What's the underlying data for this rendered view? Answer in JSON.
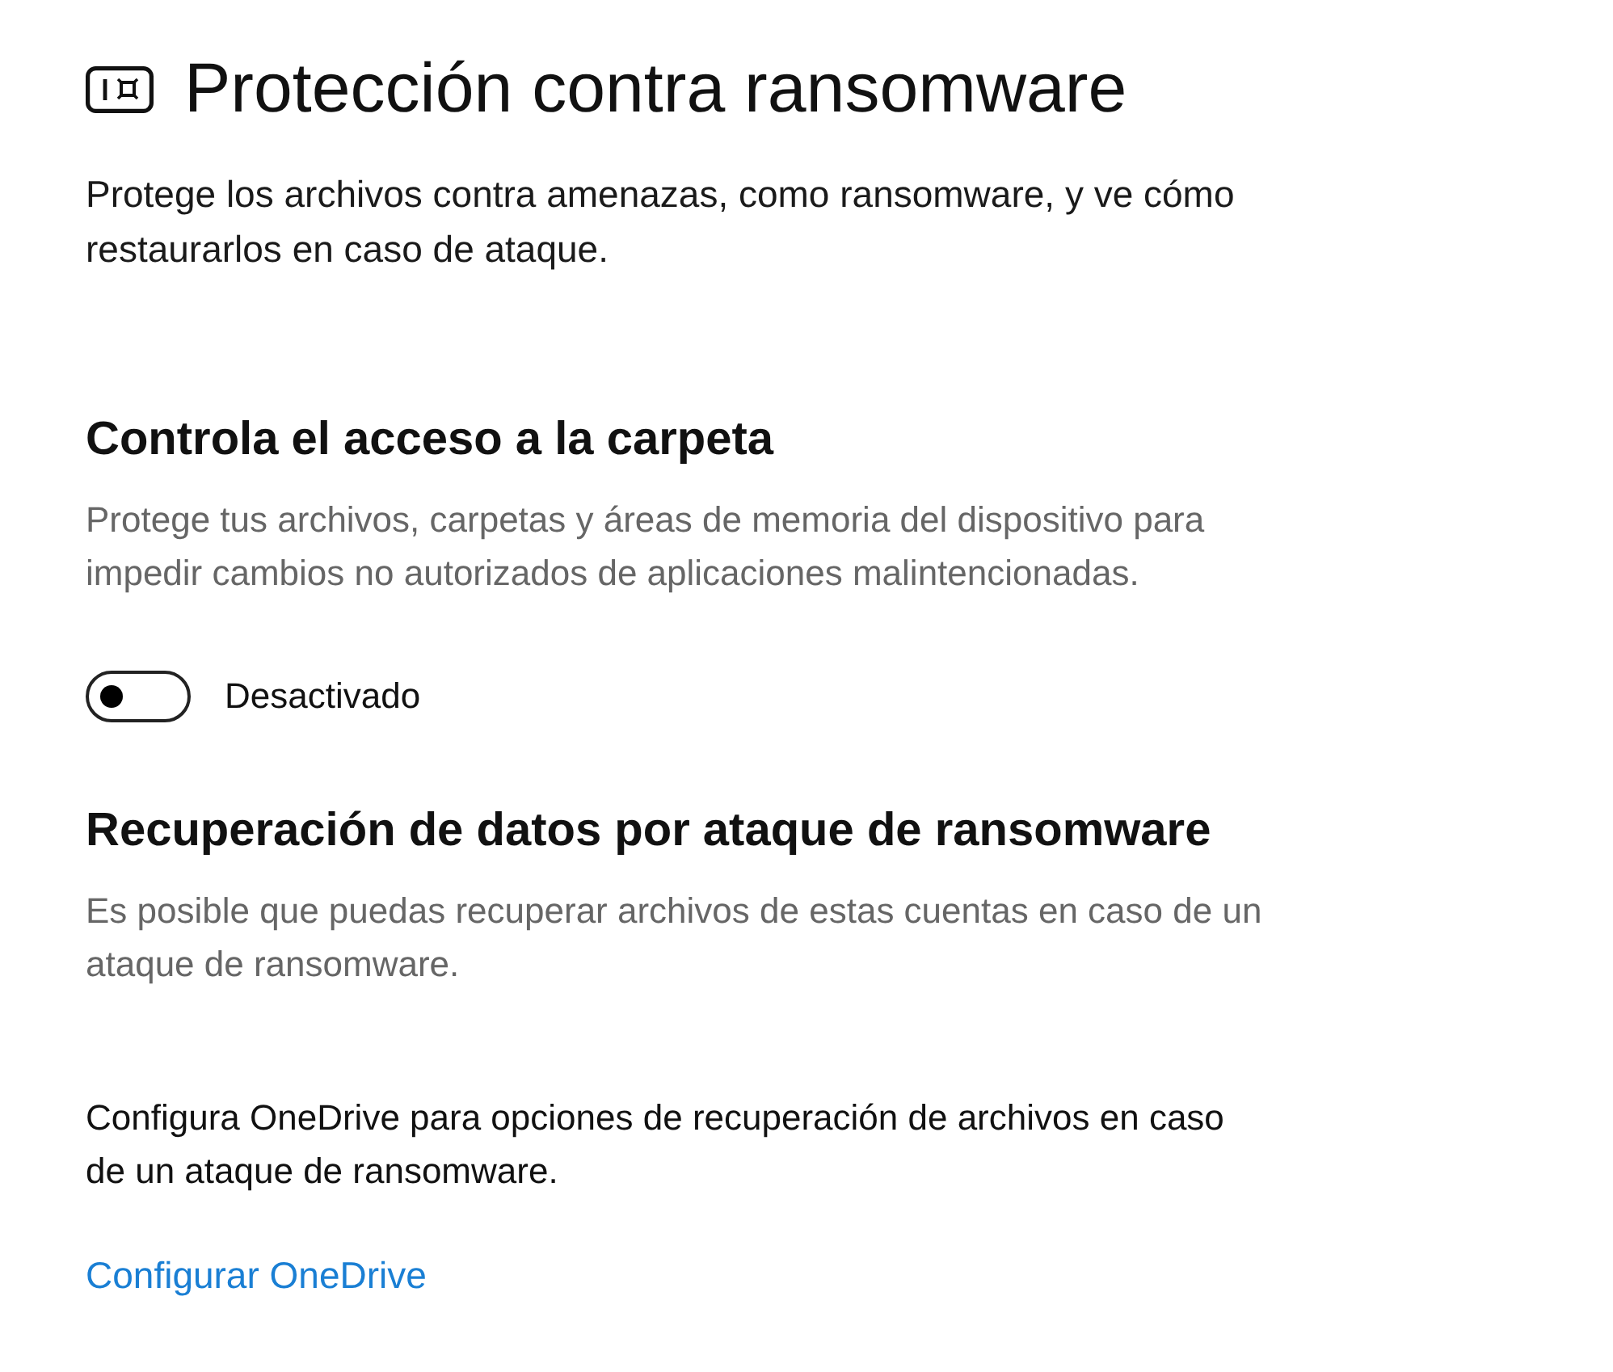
{
  "page": {
    "title": "Protección contra ransomware",
    "description": "Protege los archivos contra amenazas, como ransomware, y ve cómo restaurarlos en caso de ataque."
  },
  "sections": [
    {
      "heading": "Controla el acceso a la carpeta",
      "description": "Protege tus archivos, carpetas y áreas de memoria del dispositivo para impedir cambios no autorizados de aplicaciones malintencionadas.",
      "toggle": {
        "on": false,
        "label": "Desactivado"
      }
    },
    {
      "heading": "Recuperación de datos por ataque de ransomware",
      "description": "Es posible que puedas recuperar archivos de estas cuentas en caso de un ataque de ransomware.",
      "note": "Configura OneDrive para opciones de recuperación de archivos en caso de un ataque de ransomware.",
      "link": "Configurar OneDrive"
    }
  ]
}
